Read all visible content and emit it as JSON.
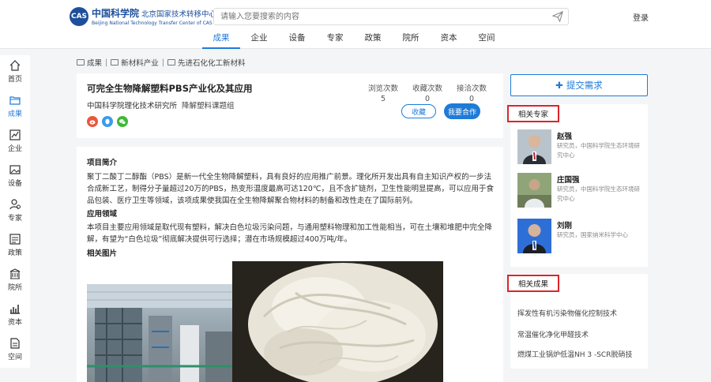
{
  "header": {
    "logo_cn": "中国科学院",
    "logo_sub": "北京国家技术转移中心",
    "logo_en": "Beijing National Technology Transfer Center of CAS",
    "search_placeholder": "请输入您要搜索的内容",
    "login": "登录",
    "nav": [
      {
        "label": "成果",
        "active": true
      },
      {
        "label": "企业"
      },
      {
        "label": "设备"
      },
      {
        "label": "专家"
      },
      {
        "label": "政策"
      },
      {
        "label": "院所"
      },
      {
        "label": "资本"
      },
      {
        "label": "空间"
      }
    ]
  },
  "sidebar": {
    "items": [
      {
        "label": "首页",
        "icon": "home-icon"
      },
      {
        "label": "成果",
        "icon": "folder-icon",
        "active": true
      },
      {
        "label": "企业",
        "icon": "chart-line-icon"
      },
      {
        "label": "设备",
        "icon": "image-icon"
      },
      {
        "label": "专家",
        "icon": "user-icon"
      },
      {
        "label": "政策",
        "icon": "document-icon"
      },
      {
        "label": "院所",
        "icon": "building-icon"
      },
      {
        "label": "资本",
        "icon": "bar-chart-icon"
      },
      {
        "label": "空间",
        "icon": "page-icon"
      }
    ]
  },
  "breadcrumb": [
    "成果",
    "新材料产业",
    "先进石化化工新材料"
  ],
  "project": {
    "title": "可完全生物降解塑料PBS产业化及其应用",
    "org": "中国科学院理化技术研究所",
    "group": "降解塑料课题组",
    "stats": [
      {
        "label": "浏览次数",
        "value": "5"
      },
      {
        "label": "收藏次数",
        "value": "0"
      },
      {
        "label": "接洽次数",
        "value": "0"
      }
    ],
    "fav_button": "收藏",
    "coop_button": "我要合作",
    "share_icons": [
      "weibo-icon",
      "qq-icon",
      "wechat-icon"
    ]
  },
  "content": {
    "intro_heading": "项目简介",
    "intro_text": "聚丁二酸丁二醇酯（PBS）是新一代全生物降解塑料，具有良好的应用推广前景。理化所开发出具有自主知识产权的一步法合成新工艺，制得分子量超过20万的PBS，热变形温度最高可达120℃，且不含扩链剂，卫生性能明显提高，可以应用于食品包装、医疗卫生等领域，该项成果使我国在全生物降解聚合物材料的制备和改性走在了国际前列。",
    "app_heading": "应用领域",
    "app_text": "本项目主要应用领域是取代现有塑料，解决白色垃圾污染问题，与通用塑料物理和加工性能相当，可在土壤和堆肥中完全降解，有望为“白色垃圾”彻底解决提供可行选择；潜在市场规模超过400万吨/年。",
    "images_heading": "相关图片"
  },
  "right": {
    "submit_button": "提交需求",
    "experts_title": "相关专家",
    "experts": [
      {
        "name": "赵强",
        "desc": "研究员，中国科学院生态环境研究中心"
      },
      {
        "name": "庄国强",
        "desc": "研究员，中国科学院生态环境研究中心"
      },
      {
        "name": "刘刚",
        "desc": "研究员，国家纳米科学中心"
      }
    ],
    "results_title": "相关成果",
    "results": [
      "挥发性有机污染物催化控制技术",
      "常温催化净化甲醛技术",
      "燃煤工业锅炉低温NH 3 -SCR脱硝技"
    ]
  },
  "colors": {
    "accent": "#1f7bd8",
    "highlight_box": "#d9262b",
    "logo_blue": "#1d4f9c"
  }
}
